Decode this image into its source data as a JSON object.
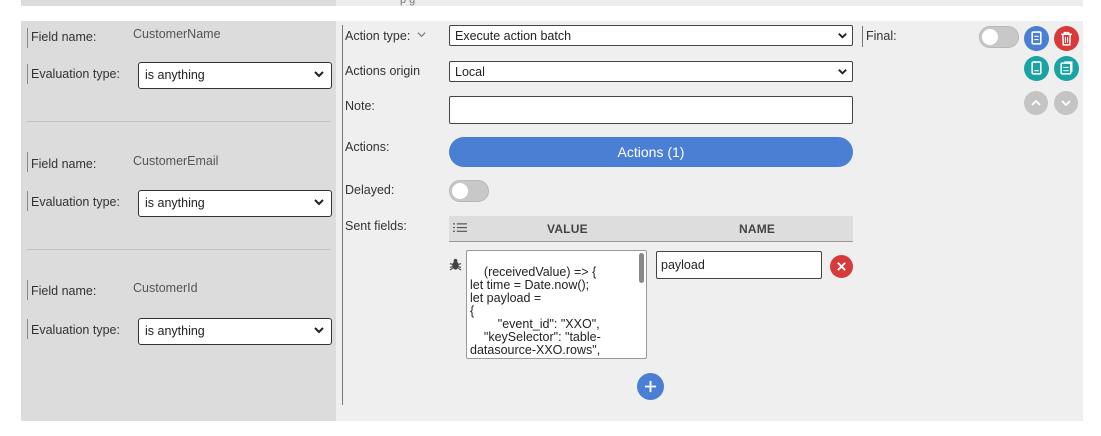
{
  "top_fragment": "p        g",
  "left": {
    "fields": [
      {
        "field_name_label": "Field name:",
        "field_name_value": "CustomerName",
        "eval_label": "Evaluation type:",
        "eval_value": "is anything"
      },
      {
        "field_name_label": "Field name:",
        "field_name_value": "CustomerEmail",
        "eval_label": "Evaluation type:",
        "eval_value": "is anything"
      },
      {
        "field_name_label": "Field name:",
        "field_name_value": "CustomerId",
        "eval_label": "Evaluation type:",
        "eval_value": "is anything"
      }
    ]
  },
  "main": {
    "action_type_label": "Action type:",
    "action_type_value": "Execute action batch",
    "actions_origin_label": "Actions origin",
    "actions_origin_value": "Local",
    "note_label": "Note:",
    "note_value": "",
    "actions_label": "Actions:",
    "actions_button": "Actions (1)",
    "delayed_label": "Delayed:",
    "delayed_on": false,
    "sent_fields_label": "Sent fields:",
    "table": {
      "value_header": "VALUE",
      "name_header": "NAME"
    },
    "sent_field_row": {
      "value_code": "(receivedValue) => {\nlet time = Date.now();\nlet payload =\n{\n        \"event_id\": \"XXO\",\n    \"keySelector\": \"table-\ndatasource-XXO.rows\",",
      "name_value": "payload"
    },
    "final_label": "Final:",
    "final_on": false
  },
  "colors": {
    "accent_blue": "#4a7fd4",
    "teal": "#1aa3a3",
    "red": "#d63a3a",
    "grey_button": "#c4c4c4"
  },
  "icons": [
    "chevron-down-icon",
    "copy-icon",
    "trash-icon",
    "export-icon",
    "import-icon",
    "move-up-icon",
    "move-down-icon",
    "list-icon",
    "debug-bug-icon",
    "remove-x-icon",
    "add-plus-icon"
  ]
}
